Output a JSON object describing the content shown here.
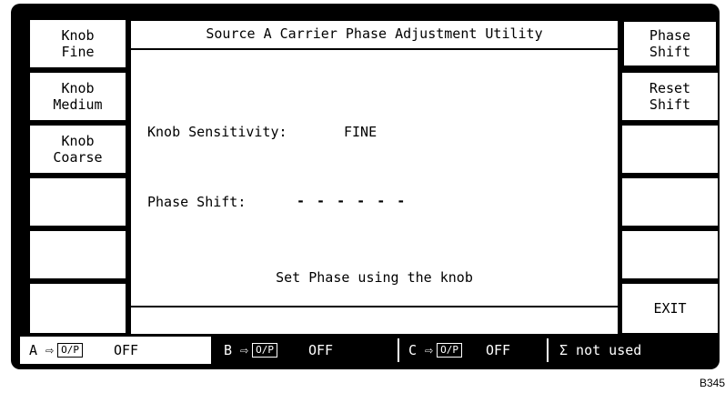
{
  "window": {
    "title": "Source A Carrier Phase Adjustment Utility"
  },
  "left_softkeys": [
    {
      "line1": "Knob",
      "line2": "Fine"
    },
    {
      "line1": "Knob",
      "line2": "Medium"
    },
    {
      "line1": "Knob",
      "line2": "Coarse"
    },
    {
      "line1": "",
      "line2": ""
    },
    {
      "line1": "",
      "line2": ""
    },
    {
      "line1": "",
      "line2": ""
    }
  ],
  "right_softkeys": [
    {
      "line1": "Phase",
      "line2": "Shift"
    },
    {
      "line1": "Reset",
      "line2": "Shift"
    },
    {
      "line1": "",
      "line2": ""
    },
    {
      "line1": "",
      "line2": ""
    },
    {
      "line1": "",
      "line2": ""
    },
    {
      "line1": "EXIT",
      "line2": ""
    }
  ],
  "main": {
    "sensitivity_label": "Knob Sensitivity:",
    "sensitivity_value": "FINE",
    "phase_label": "Phase Shift:",
    "phase_value": "- - - - - -",
    "instruction": "Set Phase using the knob"
  },
  "status_bar": {
    "a": {
      "label": "A ⇨",
      "op": "O/P",
      "state": "OFF"
    },
    "b": {
      "label": "B ⇨",
      "op": "O/P",
      "state": "OFF"
    },
    "c": {
      "label": "C ⇨",
      "op": "O/P",
      "state": "OFF"
    },
    "sigma": "Σ not used"
  },
  "figure_ref": "B345"
}
